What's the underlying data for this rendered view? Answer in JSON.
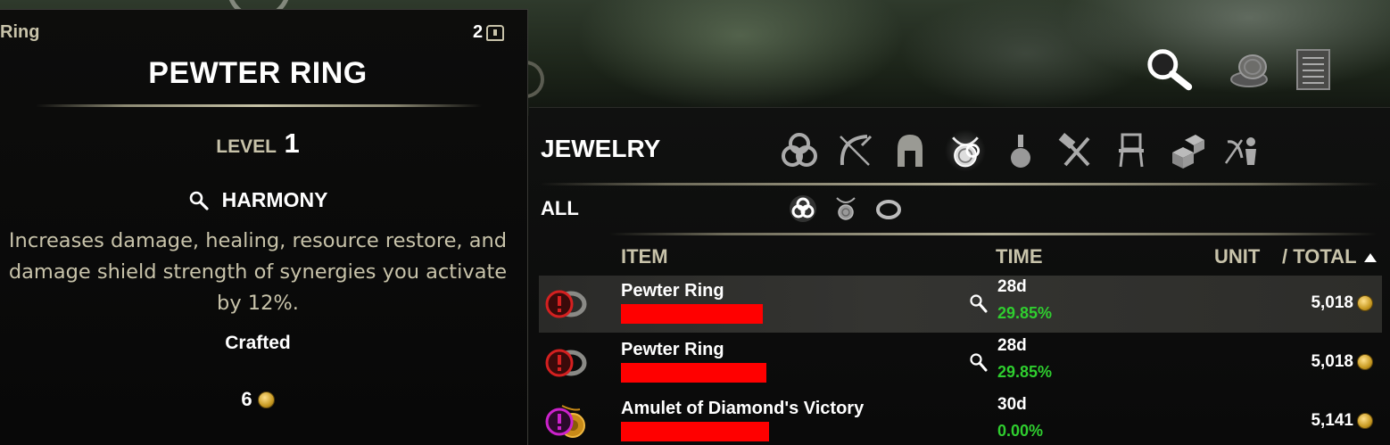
{
  "tooltip": {
    "item_type": "Ring",
    "stack_count": "2",
    "title": "PEWTER RING",
    "level_label": "LEVEL",
    "level_value": "1",
    "trait_name": "HARMONY",
    "trait_description": "Increases damage, healing, resource restore, and damage shield strength of synergies you activate by 12%.",
    "crafted_label": "Crafted",
    "value": "6"
  },
  "guild_store": {
    "category_title": "JEWELRY",
    "subcategory_title": "ALL",
    "category_icons": [
      "all-items-icon",
      "weapons-icon",
      "armor-icon",
      "jewelry-icon",
      "consumables-icon",
      "materials-icon",
      "furnishing-icon",
      "misc-icon",
      "companion-icon"
    ],
    "subcategory_icons": [
      "all-jewelry-icon",
      "necklace-icon",
      "ring-icon"
    ],
    "top_icons": [
      "search-icon",
      "sell-icon",
      "listings-icon"
    ],
    "columns": {
      "item": "ITEM",
      "time": "TIME",
      "unit": "UNIT",
      "total": "/ TOTAL"
    },
    "rows": [
      {
        "name": "Pewter Ring",
        "time": "28d",
        "percent": "29.85%",
        "total": "5,018",
        "selected": true,
        "seller_redacted": true
      },
      {
        "name": "Pewter Ring",
        "time": "28d",
        "percent": "29.85%",
        "total": "5,018",
        "selected": false,
        "seller_redacted": true
      },
      {
        "name": "Amulet of Diamond's Victory",
        "time": "30d",
        "percent": "0.00%",
        "total": "5,141",
        "selected": false,
        "seller_redacted": true
      }
    ]
  },
  "colors": {
    "label_tan": "#c8c3aa",
    "percent_green": "#2fce2f",
    "redaction_red": "#ff0000",
    "warning_red": "#d42020",
    "warning_magenta": "#cc22cc"
  }
}
